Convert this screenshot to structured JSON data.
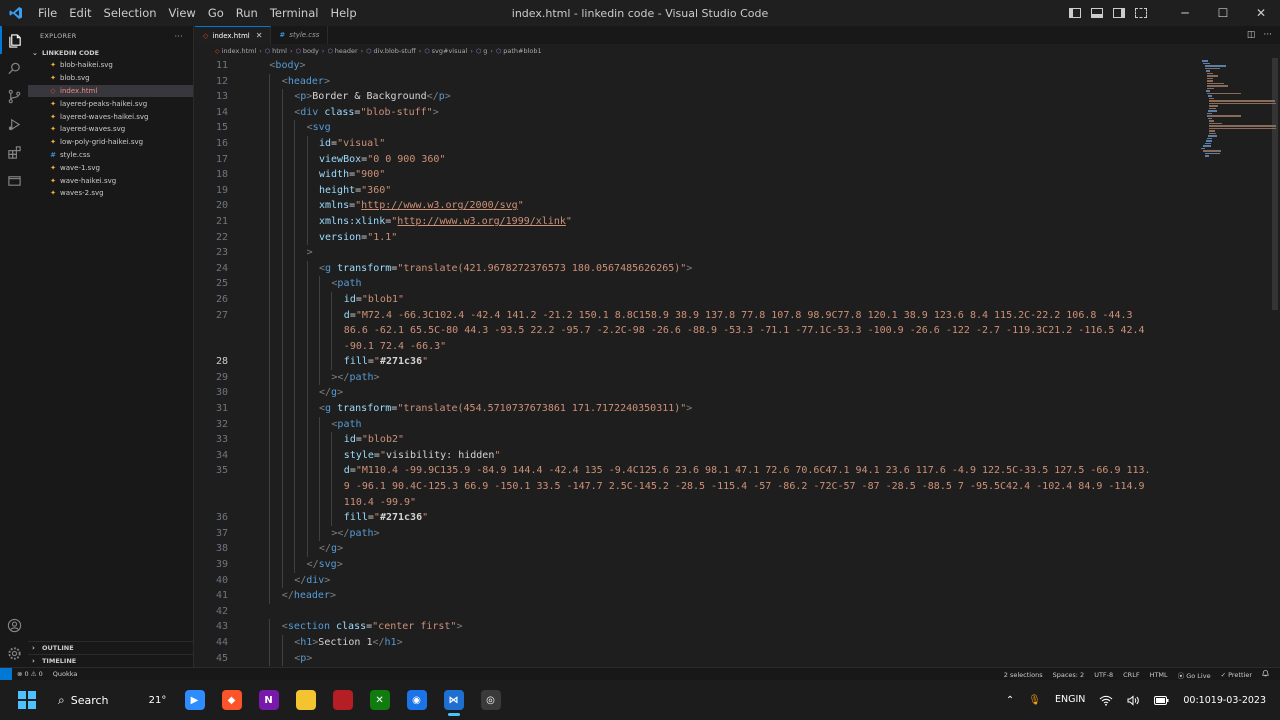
{
  "titlebar": {
    "menu": [
      "File",
      "Edit",
      "Selection",
      "View",
      "Go",
      "Run",
      "Terminal",
      "Help"
    ],
    "window_title": "index.html - linkedin code - Visual Studio Code",
    "win_minimize": "─",
    "win_maximize": "☐",
    "win_close": "✕"
  },
  "explorer": {
    "header": "EXPLORER",
    "more": "···",
    "folder": "LINKEDIN CODE",
    "files": [
      {
        "name": "blob-haikei.svg",
        "icon": "svg-icon"
      },
      {
        "name": "blob.svg",
        "icon": "svg-icon"
      },
      {
        "name": "index.html",
        "icon": "html-icon"
      },
      {
        "name": "layered-peaks-haikei.svg",
        "icon": "svg-icon"
      },
      {
        "name": "layered-waves-haikei.svg",
        "icon": "svg-icon"
      },
      {
        "name": "layered-waves.svg",
        "icon": "svg-icon"
      },
      {
        "name": "low-poly-grid-haikei.svg",
        "icon": "svg-icon"
      },
      {
        "name": "style.css",
        "icon": "css-icon"
      },
      {
        "name": "wave-1.svg",
        "icon": "svg-icon"
      },
      {
        "name": "wave-haikei.svg",
        "icon": "svg-icon"
      },
      {
        "name": "waves-2.svg",
        "icon": "svg-icon"
      }
    ],
    "active_file": "index.html",
    "outline": "OUTLINE",
    "timeline": "TIMELINE"
  },
  "tabs": [
    {
      "label": "index.html",
      "active": true,
      "close": "✕"
    },
    {
      "label": "style.css",
      "active": false
    }
  ],
  "breadcrumbs": [
    "index.html",
    "html",
    "body",
    "header",
    "div.blob-stuff",
    "svg#visual",
    "g",
    "path#blob1"
  ],
  "editor": {
    "current_line": 28,
    "lines": [
      {
        "n": 11,
        "indent": 1,
        "html": "<span class=\"t\">&lt;</span><span class=\"tg\">body</span><span class=\"t\">&gt;</span>"
      },
      {
        "n": 12,
        "indent": 2,
        "html": "<span class=\"t\">&lt;</span><span class=\"tg\">header</span><span class=\"t\">&gt;</span>"
      },
      {
        "n": 13,
        "indent": 3,
        "html": "<span class=\"t\">&lt;</span><span class=\"tg\">p</span><span class=\"t\">&gt;</span><span class=\"tx\">Border &amp; Background</span><span class=\"t\">&lt;/</span><span class=\"tg\">p</span><span class=\"t\">&gt;</span>"
      },
      {
        "n": 14,
        "indent": 3,
        "html": "<span class=\"t\">&lt;</span><span class=\"tg\">div</span> <span class=\"at\">class</span><span class=\"tx\">=</span><span class=\"st\">\"blob-stuff\"</span><span class=\"t\">&gt;</span>"
      },
      {
        "n": 15,
        "indent": 4,
        "html": "<span class=\"t\">&lt;</span><span class=\"tg\">svg</span>"
      },
      {
        "n": 16,
        "indent": 5,
        "html": "<span class=\"at\">id</span><span class=\"tx\">=</span><span class=\"st\">\"visual\"</span>"
      },
      {
        "n": 17,
        "indent": 5,
        "html": "<span class=\"at\">viewBox</span><span class=\"tx\">=</span><span class=\"st\">\"0 0 900 360\"</span>"
      },
      {
        "n": 18,
        "indent": 5,
        "html": "<span class=\"at\">width</span><span class=\"tx\">=</span><span class=\"st\">\"900\"</span>"
      },
      {
        "n": 19,
        "indent": 5,
        "html": "<span class=\"at\">height</span><span class=\"tx\">=</span><span class=\"st\">\"360\"</span>"
      },
      {
        "n": 20,
        "indent": 5,
        "html": "<span class=\"at\">xmlns</span><span class=\"tx\">=</span><span class=\"st\">\"<span class=\"u\">http://www.w3.org/2000/svg</span>\"</span>"
      },
      {
        "n": 21,
        "indent": 5,
        "html": "<span class=\"at\">xmlns:xlink</span><span class=\"tx\">=</span><span class=\"st\">\"<span class=\"u\">http://www.w3.org/1999/xlink</span>\"</span>"
      },
      {
        "n": 22,
        "indent": 5,
        "html": "<span class=\"at\">version</span><span class=\"tx\">=</span><span class=\"st\">\"1.1\"</span>"
      },
      {
        "n": 23,
        "indent": 4,
        "html": "<span class=\"t\">&gt;</span>"
      },
      {
        "n": 24,
        "indent": 5,
        "html": "<span class=\"t\">&lt;</span><span class=\"tg\">g</span> <span class=\"at\">transform</span><span class=\"tx\">=</span><span class=\"st\">\"translate(421.9678272376573 180.0567485626265)\"</span><span class=\"t\">&gt;</span>"
      },
      {
        "n": 25,
        "indent": 6,
        "html": "<span class=\"t\">&lt;</span><span class=\"tg\">path</span>"
      },
      {
        "n": 26,
        "indent": 7,
        "html": "<span class=\"at\">id</span><span class=\"tx\">=</span><span class=\"st\">\"blob1\"</span>"
      },
      {
        "n": 27,
        "indent": 7,
        "html": "<span class=\"at\">d</span><span class=\"tx\">=</span><span class=\"st\">\"M72.4 -66.3C102.4 -42.4 141.2 -21.2 150.1 8.8C158.9 38.9 137.8 77.8 107.8 98.9C77.8 120.1 38.9 123.6 8.4 115.2C-22.2 106.8 -44.3</span>"
      },
      {
        "n": null,
        "indent": 7,
        "html": "<span class=\"st\">86.6 -62.1 65.5C-80 44.3 -93.5 22.2 -95.7 -2.2C-98 -26.6 -88.9 -53.3 -71.1 -77.1C-53.3 -100.9 -26.6 -122 -2.7 -119.3C21.2 -116.5 42.4</span>"
      },
      {
        "n": null,
        "indent": 7,
        "html": "<span class=\"st\">-90.1 72.4 -66.3\"</span>"
      },
      {
        "n": 28,
        "indent": 7,
        "html": "<span class=\"at\">fill</span><span class=\"tx\">=</span><span class=\"st\">\"<span class=\"tx b\">#271c36</span>\"</span>"
      },
      {
        "n": 29,
        "indent": 6,
        "html": "<span class=\"t\">&gt;&lt;/</span><span class=\"tg\">path</span><span class=\"t\">&gt;</span>"
      },
      {
        "n": 30,
        "indent": 5,
        "html": "<span class=\"t\">&lt;/</span><span class=\"tg\">g</span><span class=\"t\">&gt;</span>"
      },
      {
        "n": 31,
        "indent": 5,
        "html": "<span class=\"t\">&lt;</span><span class=\"tg\">g</span> <span class=\"at\">transform</span><span class=\"tx\">=</span><span class=\"st\">\"translate(454.5710737673861 171.7172240350311)\"</span><span class=\"t\">&gt;</span>"
      },
      {
        "n": 32,
        "indent": 6,
        "html": "<span class=\"t\">&lt;</span><span class=\"tg\">path</span>"
      },
      {
        "n": 33,
        "indent": 7,
        "html": "<span class=\"at\">id</span><span class=\"tx\">=</span><span class=\"st\">\"blob2\"</span>"
      },
      {
        "n": 34,
        "indent": 7,
        "html": "<span class=\"at\">style</span><span class=\"tx\">=</span><span class=\"st\">\"<span class=\"tx\">visibility: hidden</span>\"</span>"
      },
      {
        "n": 35,
        "indent": 7,
        "html": "<span class=\"at\">d</span><span class=\"tx\">=</span><span class=\"st\">\"M110.4 -99.9C135.9 -84.9 144.4 -42.4 135 -9.4C125.6 23.6 98.1 47.1 72.6 70.6C47.1 94.1 23.6 117.6 -4.9 122.5C-33.5 127.5 -66.9 113.</span>"
      },
      {
        "n": null,
        "indent": 7,
        "html": "<span class=\"st\">9 -96.1 90.4C-125.3 66.9 -150.1 33.5 -147.7 2.5C-145.2 -28.5 -115.4 -57 -86.2 -72C-57 -87 -28.5 -88.5 7 -95.5C42.4 -102.4 84.9 -114.9</span>"
      },
      {
        "n": null,
        "indent": 7,
        "html": "<span class=\"st\">110.4 -99.9\"</span>"
      },
      {
        "n": 36,
        "indent": 7,
        "html": "<span class=\"at\">fill</span><span class=\"tx\">=</span><span class=\"st\">\"<span class=\"tx b\">#271c36</span>\"</span>"
      },
      {
        "n": 37,
        "indent": 6,
        "html": "<span class=\"t\">&gt;&lt;/</span><span class=\"tg\">path</span><span class=\"t\">&gt;</span>"
      },
      {
        "n": 38,
        "indent": 5,
        "html": "<span class=\"t\">&lt;/</span><span class=\"tg\">g</span><span class=\"t\">&gt;</span>"
      },
      {
        "n": 39,
        "indent": 4,
        "html": "<span class=\"t\">&lt;/</span><span class=\"tg\">svg</span><span class=\"t\">&gt;</span>"
      },
      {
        "n": 40,
        "indent": 3,
        "html": "<span class=\"t\">&lt;/</span><span class=\"tg\">div</span><span class=\"t\">&gt;</span>"
      },
      {
        "n": 41,
        "indent": 2,
        "html": "<span class=\"t\">&lt;/</span><span class=\"tg\">header</span><span class=\"t\">&gt;</span>"
      },
      {
        "n": 42,
        "indent": 0,
        "html": ""
      },
      {
        "n": 43,
        "indent": 2,
        "html": "<span class=\"t\">&lt;</span><span class=\"tg\">section</span> <span class=\"at\">class</span><span class=\"tx\">=</span><span class=\"st\">\"center first\"</span><span class=\"t\">&gt;</span>"
      },
      {
        "n": 44,
        "indent": 3,
        "html": "<span class=\"t\">&lt;</span><span class=\"tg\">h1</span><span class=\"t\">&gt;</span><span class=\"tx\">Section 1</span><span class=\"t\">&lt;/</span><span class=\"tg\">h1</span><span class=\"t\">&gt;</span>"
      },
      {
        "n": 45,
        "indent": 3,
        "html": "<span class=\"t\">&lt;</span><span class=\"tg\">p</span><span class=\"t\">&gt;</span>"
      }
    ]
  },
  "statusbar": {
    "problems": "⊗ 0 ⚠ 0",
    "quokka": "Quokka",
    "selections": "2 selections",
    "spaces": "Spaces: 2",
    "encoding": "UTF-8",
    "eol": "CRLF",
    "language": "HTML",
    "golive": "⦿ Go Live",
    "prettier": "✓ Prettier",
    "bell": "🔔"
  },
  "taskbar": {
    "search_label": "Search",
    "weather_temp": "21°",
    "apps": [
      {
        "name": "zoom-icon",
        "color": "#2d8cff",
        "glyph": "▶"
      },
      {
        "name": "brave-icon",
        "color": "#fb542b",
        "glyph": "◆"
      },
      {
        "name": "onenote-icon",
        "color": "#7719aa",
        "glyph": "N"
      },
      {
        "name": "file-explorer-icon",
        "color": "#f4c430",
        "glyph": ""
      },
      {
        "name": "app-red-icon",
        "color": "#b41e24",
        "glyph": ""
      },
      {
        "name": "xbox-icon",
        "color": "#107c10",
        "glyph": "✕"
      },
      {
        "name": "firefox-icon",
        "color": "#1a73e8",
        "glyph": "◉"
      },
      {
        "name": "vscode-icon",
        "color": "#1f6fd1",
        "glyph": "⋈",
        "active": true
      },
      {
        "name": "chrome-icon",
        "color": "#3a3a3a",
        "glyph": "◎"
      }
    ],
    "lang_top": "ENG",
    "lang_bottom": "IN",
    "time": "00:10",
    "date": "19-03-2023"
  },
  "colors": {
    "accent": "#0078d4",
    "editor_bg": "#1e1e1e"
  }
}
